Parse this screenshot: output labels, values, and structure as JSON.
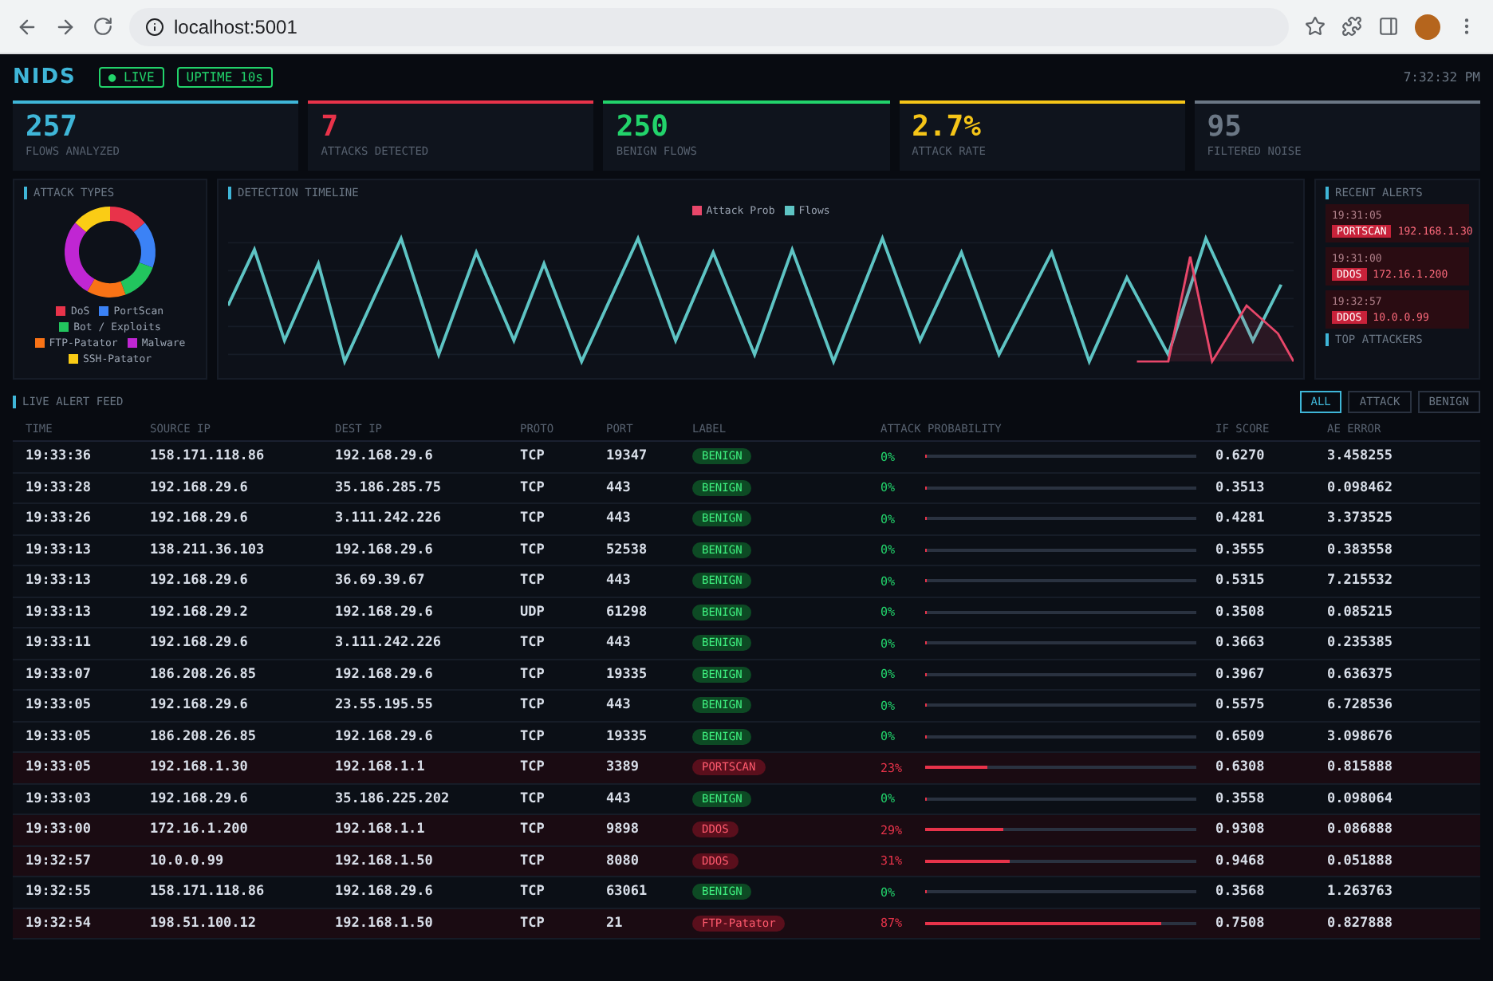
{
  "browser": {
    "url": "localhost:5001"
  },
  "header": {
    "logo": "NIDS",
    "badges": [
      "● LIVE",
      "UPTIME 10s"
    ],
    "clock": "7:32:32 PM"
  },
  "kpis": [
    {
      "value": "257",
      "label": "FLOWS ANALYZED",
      "color": "#3fb6d8"
    },
    {
      "value": "7",
      "label": "ATTACKS DETECTED",
      "color": "#e8334a"
    },
    {
      "value": "250",
      "label": "BENIGN FLOWS",
      "color": "#22d36b"
    },
    {
      "value": "2.7%",
      "label": "ATTACK RATE",
      "color": "#f5c518"
    },
    {
      "value": "95",
      "label": "FILTERED NOISE",
      "color": "#6b7785"
    }
  ],
  "attack_types": {
    "title": "ATTACK TYPES",
    "legend": [
      {
        "label": "DoS",
        "color": "#e8334a"
      },
      {
        "label": "PortScan",
        "color": "#3b82f6"
      },
      {
        "label": "Bot / Exploits",
        "color": "#22c55e"
      },
      {
        "label": "FTP-Patator",
        "color": "#f97316"
      },
      {
        "label": "Malware",
        "color": "#c026d3"
      },
      {
        "label": "SSH-Patator",
        "color": "#facc15"
      }
    ]
  },
  "timeline": {
    "title": "DETECTION TIMELINE",
    "legend": [
      {
        "label": "Attack Prob",
        "color": "#e8476a"
      },
      {
        "label": "Flows",
        "color": "#5ec4c4"
      }
    ]
  },
  "recent_alerts": {
    "title": "RECENT ALERTS",
    "items": [
      {
        "time": "19:31:05",
        "tag": "PORTSCAN",
        "ip": "192.168.1.30"
      },
      {
        "time": "19:31:00",
        "tag": "DDOS",
        "ip": "172.16.1.200"
      },
      {
        "time": "19:32:57",
        "tag": "DDOS",
        "ip": "10.0.0.99"
      }
    ],
    "next_title": "TOP ATTACKERS"
  },
  "feed": {
    "title": "LIVE ALERT FEED",
    "filters": [
      {
        "label": "ALL",
        "selected": true
      },
      {
        "label": "ATTACK",
        "selected": false
      },
      {
        "label": "BENIGN",
        "selected": false
      }
    ],
    "columns": [
      "TIME",
      "SOURCE IP",
      "DEST IP",
      "PROTO",
      "PORT",
      "LABEL",
      "ATTACK PROBABILITY",
      "IF SCORE",
      "AE ERROR"
    ],
    "rows": [
      {
        "time": "19:33:36",
        "src": "158.171.118.86",
        "dst": "192.168.29.6",
        "proto": "TCP",
        "port": "19347",
        "label": "BENIGN",
        "kind": "benign",
        "prob": "0%",
        "level": 0,
        "if_score": "0.6270",
        "ae": "3.458255"
      },
      {
        "time": "19:33:28",
        "src": "192.168.29.6",
        "dst": "35.186.285.75",
        "proto": "TCP",
        "port": "443",
        "label": "BENIGN",
        "kind": "benign",
        "prob": "0%",
        "level": 0,
        "if_score": "0.3513",
        "ae": "0.098462"
      },
      {
        "time": "19:33:26",
        "src": "192.168.29.6",
        "dst": "3.111.242.226",
        "proto": "TCP",
        "port": "443",
        "label": "BENIGN",
        "kind": "benign",
        "prob": "0%",
        "level": 0,
        "if_score": "0.4281",
        "ae": "3.373525"
      },
      {
        "time": "19:33:13",
        "src": "138.211.36.103",
        "dst": "192.168.29.6",
        "proto": "TCP",
        "port": "52538",
        "label": "BENIGN",
        "kind": "benign",
        "prob": "0%",
        "level": 0,
        "if_score": "0.3555",
        "ae": "0.383558"
      },
      {
        "time": "19:33:13",
        "src": "192.168.29.6",
        "dst": "36.69.39.67",
        "proto": "TCP",
        "port": "443",
        "label": "BENIGN",
        "kind": "benign",
        "prob": "0%",
        "level": 0,
        "if_score": "0.5315",
        "ae": "7.215532"
      },
      {
        "time": "19:33:13",
        "src": "192.168.29.2",
        "dst": "192.168.29.6",
        "proto": "UDP",
        "port": "61298",
        "label": "BENIGN",
        "kind": "benign",
        "prob": "0%",
        "level": 0,
        "if_score": "0.3508",
        "ae": "0.085215"
      },
      {
        "time": "19:33:11",
        "src": "192.168.29.6",
        "dst": "3.111.242.226",
        "proto": "TCP",
        "port": "443",
        "label": "BENIGN",
        "kind": "benign",
        "prob": "0%",
        "level": 0,
        "if_score": "0.3663",
        "ae": "0.235385"
      },
      {
        "time": "19:33:07",
        "src": "186.208.26.85",
        "dst": "192.168.29.6",
        "proto": "TCP",
        "port": "19335",
        "label": "BENIGN",
        "kind": "benign",
        "prob": "0%",
        "level": 0,
        "if_score": "0.3967",
        "ae": "0.636375"
      },
      {
        "time": "19:33:05",
        "src": "192.168.29.6",
        "dst": "23.55.195.55",
        "proto": "TCP",
        "port": "443",
        "label": "BENIGN",
        "kind": "benign",
        "prob": "0%",
        "level": 0,
        "if_score": "0.5575",
        "ae": "6.728536"
      },
      {
        "time": "19:33:05",
        "src": "186.208.26.85",
        "dst": "192.168.29.6",
        "proto": "TCP",
        "port": "19335",
        "label": "BENIGN",
        "kind": "benign",
        "prob": "0%",
        "level": 0,
        "if_score": "0.6509",
        "ae": "3.098676"
      },
      {
        "time": "19:33:05",
        "src": "192.168.1.30",
        "dst": "192.168.1.1",
        "proto": "TCP",
        "port": "3389",
        "label": "PORTSCAN",
        "kind": "attack",
        "prob": "23%",
        "level": 0.23,
        "if_score": "0.6308",
        "ae": "0.815888"
      },
      {
        "time": "19:33:03",
        "src": "192.168.29.6",
        "dst": "35.186.225.202",
        "proto": "TCP",
        "port": "443",
        "label": "BENIGN",
        "kind": "benign",
        "prob": "0%",
        "level": 0,
        "if_score": "0.3558",
        "ae": "0.098064"
      },
      {
        "time": "19:33:00",
        "src": "172.16.1.200",
        "dst": "192.168.1.1",
        "proto": "TCP",
        "port": "9898",
        "label": "DDOS",
        "kind": "attack",
        "prob": "29%",
        "level": 0.29,
        "if_score": "0.9308",
        "ae": "0.086888"
      },
      {
        "time": "19:32:57",
        "src": "10.0.0.99",
        "dst": "192.168.1.50",
        "proto": "TCP",
        "port": "8080",
        "label": "DDOS",
        "kind": "attack",
        "prob": "31%",
        "level": 0.31,
        "if_score": "0.9468",
        "ae": "0.051888"
      },
      {
        "time": "19:32:55",
        "src": "158.171.118.86",
        "dst": "192.168.29.6",
        "proto": "TCP",
        "port": "63061",
        "label": "BENIGN",
        "kind": "benign",
        "prob": "0%",
        "level": 0,
        "if_score": "0.3568",
        "ae": "1.263763"
      },
      {
        "time": "19:32:54",
        "src": "198.51.100.12",
        "dst": "192.168.1.50",
        "proto": "TCP",
        "port": "21",
        "label": "FTP-Patator",
        "kind": "attack",
        "prob": "87%",
        "level": 0.87,
        "if_score": "0.7508",
        "ae": "0.827888"
      }
    ]
  }
}
